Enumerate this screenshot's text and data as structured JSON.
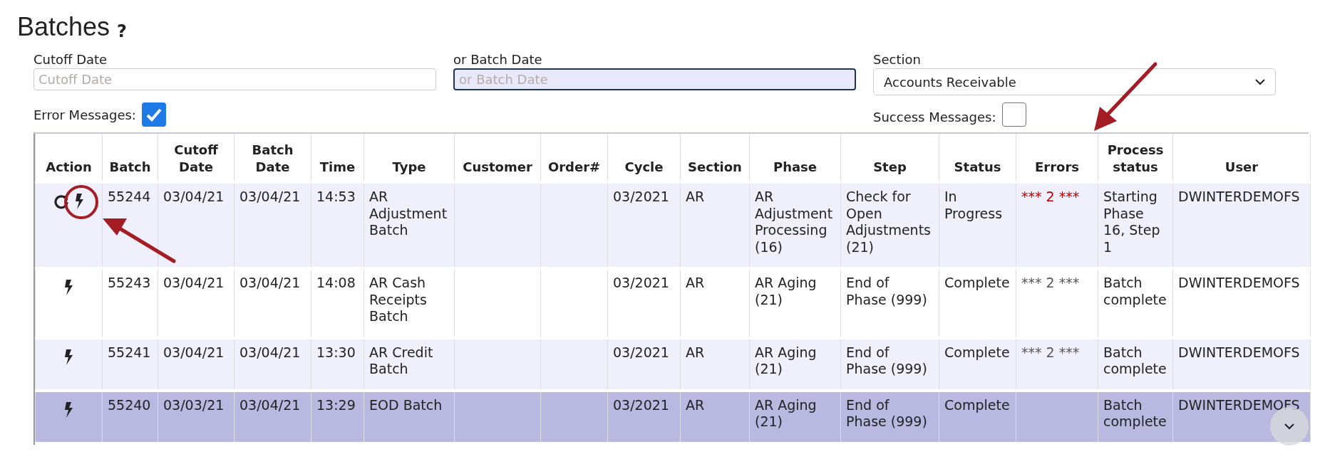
{
  "page": {
    "title": "Batches",
    "help": "?"
  },
  "filters": {
    "cutoff_date": {
      "label": "Cutoff Date",
      "placeholder": "Cutoff Date",
      "focused": false
    },
    "batch_date": {
      "label": "or Batch Date",
      "placeholder": "or Batch Date",
      "focused": true
    },
    "section": {
      "label": "Section",
      "value": "Accounts Receivable"
    },
    "error_messages": {
      "label": "Error Messages:",
      "checked": true
    },
    "success_messages": {
      "label": "Success Messages:",
      "checked": false
    }
  },
  "table": {
    "columns": [
      [
        "Action"
      ],
      [
        "Batch"
      ],
      [
        "Cutoff",
        "Date"
      ],
      [
        "Batch",
        "Date"
      ],
      [
        "Time"
      ],
      [
        "Type"
      ],
      [
        "Customer"
      ],
      [
        "Order#"
      ],
      [
        "Cycle"
      ],
      [
        "Section"
      ],
      [
        "Phase"
      ],
      [
        "Step"
      ],
      [
        "Status"
      ],
      [
        "Errors"
      ],
      [
        "Process",
        "status"
      ],
      [
        "User"
      ]
    ],
    "rows": [
      {
        "selected": false,
        "restartable": true,
        "batch": "55244",
        "cutoff_date": "03/04/21",
        "batch_date": "03/04/21",
        "time": "14:53",
        "type": "AR Adjustment Batch",
        "cycle": "03/2021",
        "section": "AR",
        "phase": "AR Adjustment Processing (16)",
        "step": "Check for Open Adjustments (21)",
        "status": "In Progress",
        "errors": {
          "text": "*** 2 ***",
          "alert": true
        },
        "process_status": "Starting Phase 16, Step 1",
        "user": "DWINTERDEMOFS"
      },
      {
        "selected": false,
        "restartable": false,
        "batch": "55243",
        "cutoff_date": "03/04/21",
        "batch_date": "03/04/21",
        "time": "14:08",
        "type": "AR Cash Receipts Batch",
        "cycle": "03/2021",
        "section": "AR",
        "phase": "AR Aging (21)",
        "step": "End of Phase (999)",
        "status": "Complete",
        "errors": {
          "text": "*** 2 ***",
          "alert": false
        },
        "process_status": "Batch complete",
        "user": "DWINTERDEMOFS"
      },
      {
        "selected": false,
        "restartable": false,
        "batch": "55241",
        "cutoff_date": "03/04/21",
        "batch_date": "03/04/21",
        "time": "13:30",
        "type": "AR Credit Batch",
        "cycle": "03/2021",
        "section": "AR",
        "phase": "AR Aging (21)",
        "step": "End of Phase (999)",
        "status": "Complete",
        "errors": {
          "text": "*** 2 ***",
          "alert": false
        },
        "process_status": "Batch complete",
        "user": "DWINTERDEMOFS"
      },
      {
        "selected": true,
        "restartable": false,
        "batch": "55240",
        "cutoff_date": "03/03/21",
        "batch_date": "03/04/21",
        "time": "13:29",
        "type": "EOD Batch",
        "cycle": "03/2021",
        "section": "AR",
        "phase": "AR Aging (21)",
        "step": "End of Phase (999)",
        "status": "Complete",
        "process_status": "Batch complete",
        "user": "DWINTERDEMOFS"
      }
    ]
  }
}
